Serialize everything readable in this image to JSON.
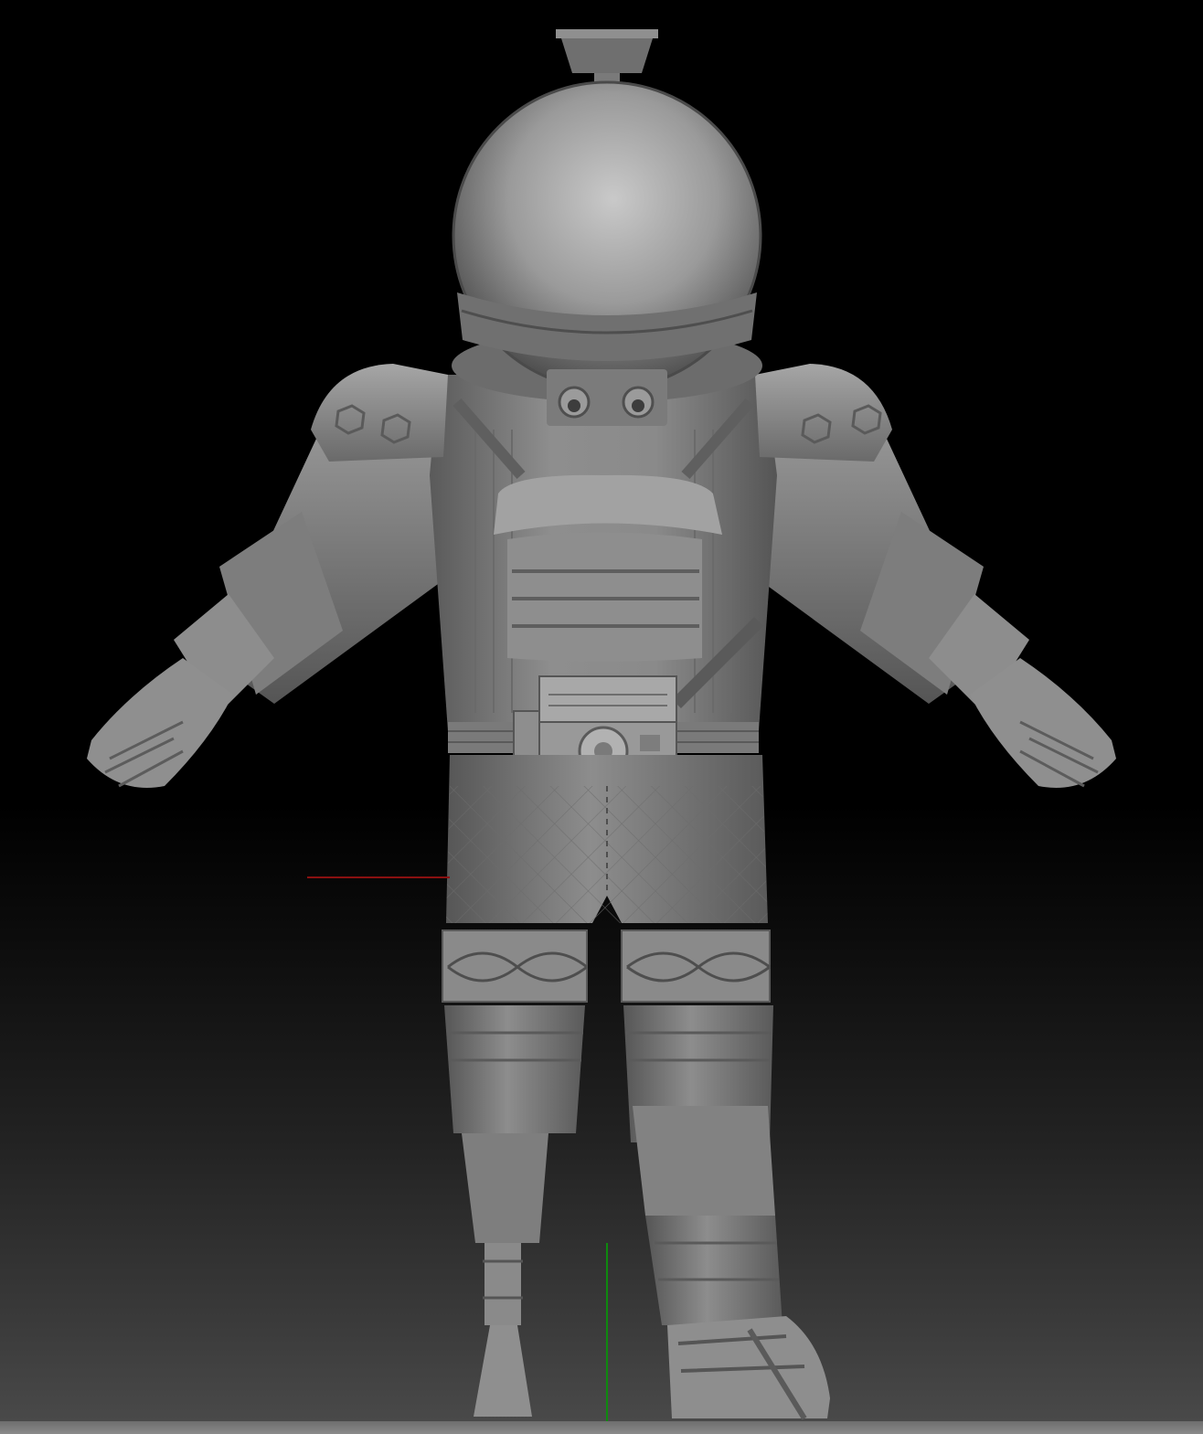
{
  "viewport": {
    "background_top": "#000000",
    "background_bottom": "#4b4b4b",
    "floor_color": "#7a7a7a"
  },
  "model": {
    "subject": "astronaut-suit-sculpt",
    "material": "gray-clay",
    "base_color": "#8c8c8c"
  },
  "axis_gizmo": {
    "x_axis_color": "#8a1010",
    "y_axis_color": "#0e8a0e"
  }
}
